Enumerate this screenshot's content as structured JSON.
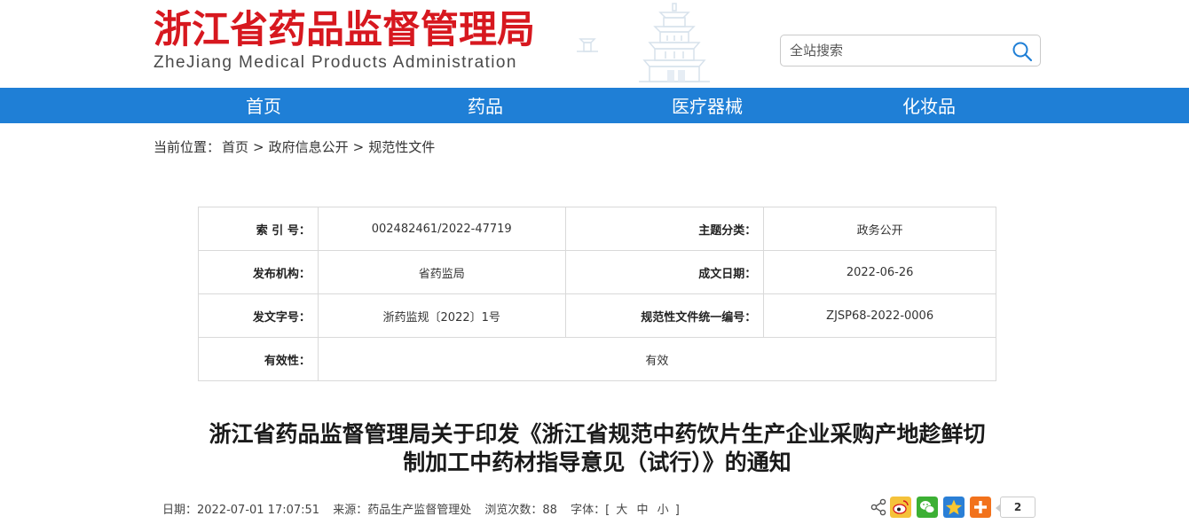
{
  "header": {
    "title_cn": "浙江省药品监督管理局",
    "title_en": "ZheJiang Medical Products Administration"
  },
  "search": {
    "placeholder": "全站搜索",
    "icon": "search-icon"
  },
  "nav": {
    "items": [
      "首页",
      "药品",
      "医疗器械",
      "化妆品"
    ]
  },
  "breadcrumb": {
    "prefix": "当前位置：",
    "items": [
      "首页",
      "政府信息公开",
      "规范性文件"
    ],
    "separator": ">"
  },
  "info": {
    "index_label": "索 引 号：",
    "index_value": "002482461/2022-47719",
    "category_label": "主题分类：",
    "category_value": "政务公开",
    "publisher_label": "发布机构：",
    "publisher_value": "省药监局",
    "date_label": "成文日期：",
    "date_value": "2022-06-26",
    "docno_label": "发文字号：",
    "docno_value": "浙药监规〔2022〕1号",
    "code_label": "规范性文件统一编号：",
    "code_value": "ZJSP68-2022-0006",
    "validity_label": "有效性：",
    "validity_value": "有效"
  },
  "article": {
    "title_line1": "浙江省药品监督管理局关于印发《浙江省规范中药饮片生产企业采购产地趁鲜切",
    "title_line2": "制加工中药材指导意见（试行）》的通知"
  },
  "meta": {
    "date": "日期：2022-07-01 17:07:51",
    "source": "来源：药品生产监督管理处",
    "views": "浏览次数：88",
    "font_label": "字体：[",
    "font_large": "大",
    "font_medium": "中",
    "font_small": "小",
    "font_close": "]"
  },
  "share": {
    "count": "2",
    "icons": [
      "share-icon",
      "weibo-icon",
      "wechat-icon",
      "qzone-icon",
      "more-icon"
    ]
  },
  "colors": {
    "brand_red": "#d7181f",
    "nav_blue": "#1f7fd6"
  }
}
